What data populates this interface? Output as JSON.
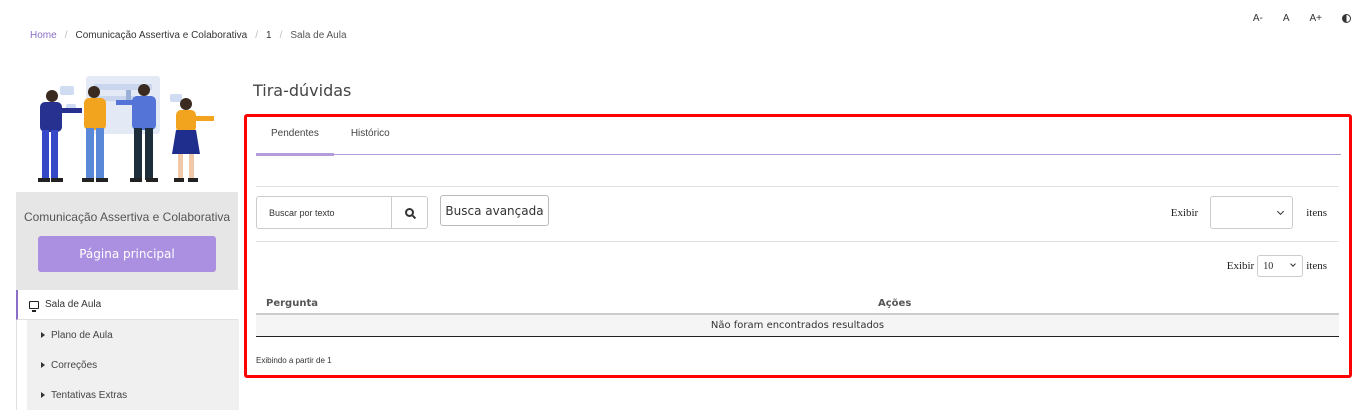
{
  "breadcrumb": {
    "home": "Home",
    "separator": "/",
    "course": "Comunicação Assertiva e Colaborativa",
    "number": "1",
    "current": "Sala de Aula"
  },
  "accessibility": {
    "decrease": "A-",
    "normal": "A",
    "increase": "A+",
    "contrast_icon": "contrast-icon"
  },
  "sidebar": {
    "course_title": "Comunicação Assertiva e Colaborativa",
    "main_button": "Página principal",
    "active_item": {
      "label": "Sala de Aula",
      "icon": "monitor-icon"
    },
    "sub_items": [
      {
        "label": "Plano de Aula"
      },
      {
        "label": "Correções"
      },
      {
        "label": "Tentativas Extras"
      }
    ]
  },
  "page": {
    "title": "Tira-dúvidas",
    "tabs": [
      {
        "label": "Pendentes",
        "active": true
      },
      {
        "label": "Histórico",
        "active": false
      }
    ],
    "search_placeholder": "Buscar por texto",
    "advanced_search": "Busca avançada",
    "exibir_label": "Exibir",
    "itens_label": "itens",
    "page_size_value": "10",
    "table": {
      "columns": [
        "Pergunta",
        "Ações"
      ],
      "empty_message": "Não foram encontrados resultados"
    },
    "info_text": "Exibindo a partir de 1"
  },
  "colors": {
    "accent": "#ab8fe0",
    "link": "#8b6fc7",
    "highlight_border": "#ff0000"
  }
}
